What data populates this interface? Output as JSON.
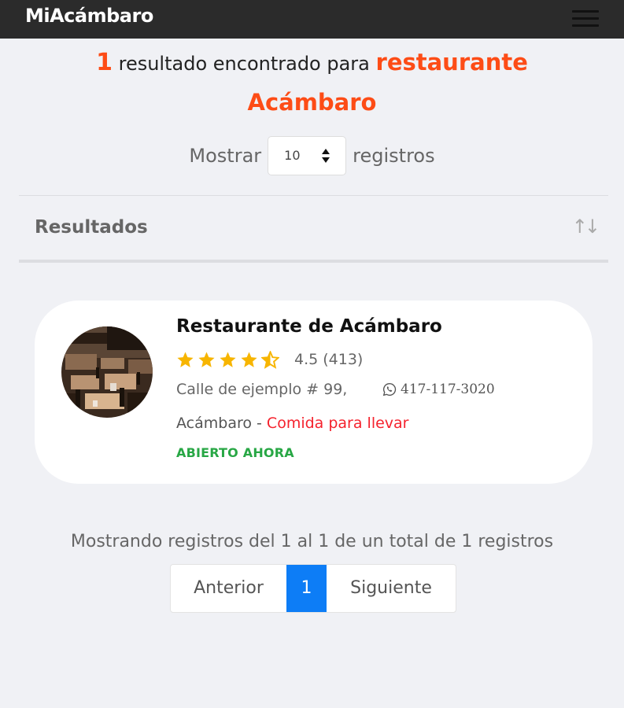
{
  "navbar": {
    "brand": "MiAcámbaro",
    "menu_icon": "hamburger-menu-icon"
  },
  "headline": {
    "count": "1",
    "text": " resultado encontrado para ",
    "term": "restaurante Acámbaro",
    "accent_color": "#fd4c16"
  },
  "length_control": {
    "prefix": "Mostrar",
    "selected": "10",
    "suffix": "registros"
  },
  "results_header": {
    "label": "Resultados",
    "sort_icon": "sort-arrows-icon"
  },
  "results": [
    {
      "name": "Restaurante de Acámbaro",
      "rating_value": 4.5,
      "rating_text": "4.5 (413)",
      "address": "Calle de ejemplo # 99,",
      "phone": "417-117-3020",
      "phone_icon": "whatsapp-icon",
      "city": "Acámbaro",
      "separator": " - ",
      "category": "Comida para llevar",
      "status": "ABIERTO AHORA",
      "status_color": "#28a745",
      "photo": "restaurant-photo"
    }
  ],
  "table_info": "Mostrando registros del 1 al 1 de un total de 1 registros",
  "pagination": {
    "previous": "Anterior",
    "current": "1",
    "next": "Siguiente",
    "active_color": "#0d7df6"
  }
}
